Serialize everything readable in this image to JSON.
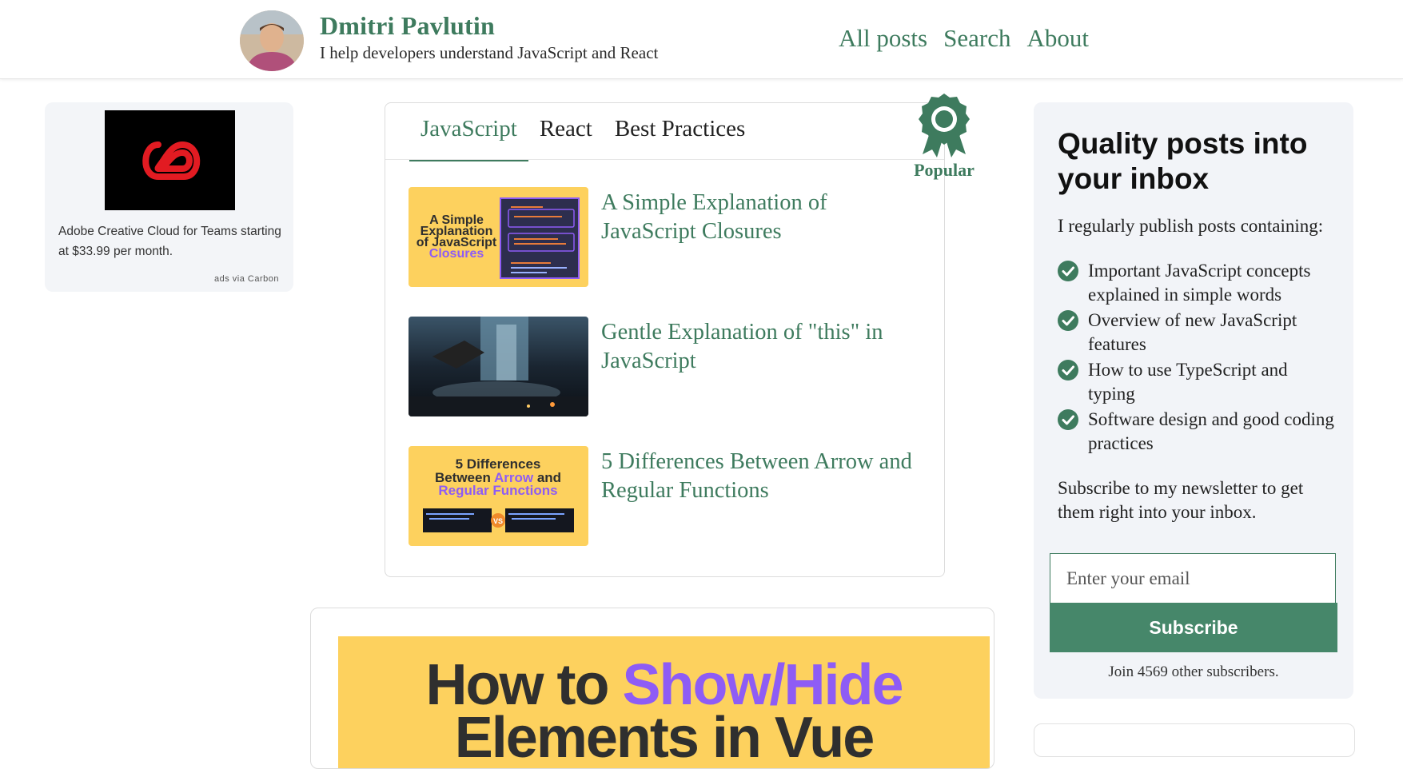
{
  "header": {
    "name": "Dmitri Pavlutin",
    "tagline": "I help developers understand JavaScript and React",
    "nav": [
      "All posts",
      "Search",
      "About"
    ]
  },
  "ad": {
    "text": "Adobe Creative Cloud for Teams starting at $33.99 per month.",
    "via": "ads via Carbon"
  },
  "popular": {
    "badge": "Popular",
    "tabs": [
      "JavaScript",
      "React",
      "Best Practices"
    ],
    "active_tab": "JavaScript",
    "posts": [
      {
        "title": "A Simple Explanation of JavaScript Closures",
        "thumb_lines": [
          "A Simple",
          "Explanation",
          "of JavaScript"
        ],
        "thumb_accent": "Closures"
      },
      {
        "title": "Gentle Explanation of \"this\" in JavaScript"
      },
      {
        "title": "5 Differences Between Arrow and Regular Functions",
        "thumb_line1": "5 Differences",
        "thumb_line2a": "Between",
        "thumb_line2b": "Arrow",
        "thumb_line2c": "and",
        "thumb_line3": "Regular Functions",
        "thumb_vs": "VS"
      }
    ]
  },
  "feature": {
    "title_plain": "How to",
    "title_accent": "Show/Hide",
    "title_line2": "Elements in Vue"
  },
  "newsletter": {
    "heading": "Quality posts into your inbox",
    "intro": "I regularly publish posts containing:",
    "items": [
      "Important JavaScript concepts explained in simple words",
      "Overview of new JavaScript features",
      "How to use TypeScript and typing",
      "Software design and good coding practices"
    ],
    "cta": "Subscribe to my newsletter to get them right into your inbox.",
    "email_placeholder": "Enter your email",
    "button": "Subscribe",
    "subscriber_note": "Join 4569 other subscribers."
  },
  "colors": {
    "brand_green": "#3e7b5e",
    "button_green": "#46876a",
    "thumb_yellow": "#fdd15e",
    "accent_purple": "#8e5cf5"
  }
}
